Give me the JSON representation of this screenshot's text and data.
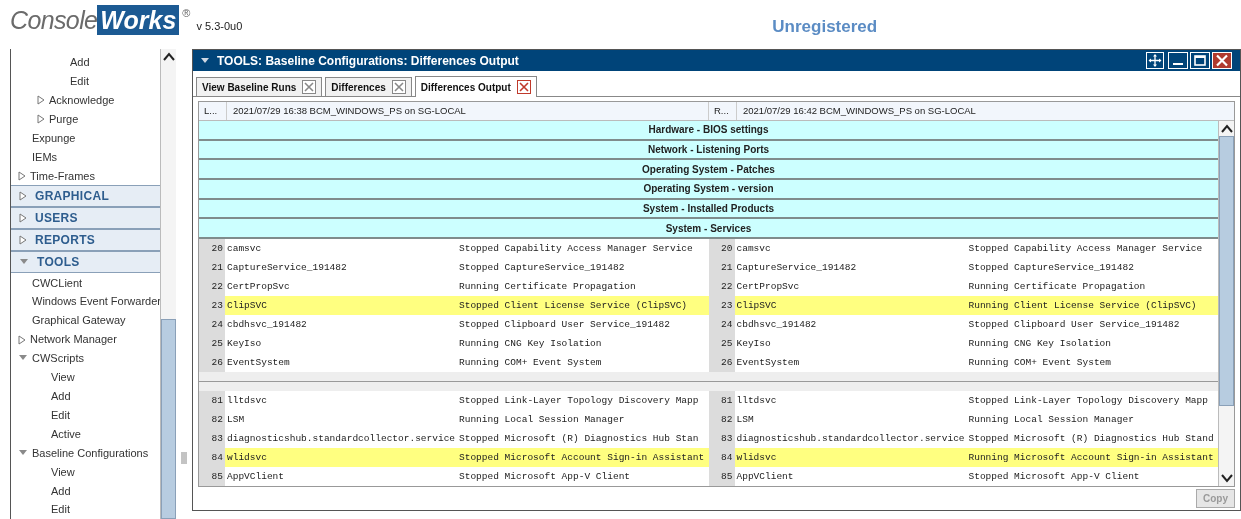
{
  "header": {
    "logo_left": "Console",
    "logo_right": "Works",
    "logo_mark": "®",
    "version": "v 5.3-0u0",
    "license": "Unregistered"
  },
  "sidebar": {
    "sections": [
      {
        "items": [
          {
            "children": [
              {
                "children": [
                  {
                    "label": "Add"
                  },
                  {
                    "label": "Edit"
                  }
                ]
              },
              {
                "label": "Acknowledge",
                "expanded": false
              },
              {
                "label": "Purge",
                "expanded": false
              }
            ]
          },
          {
            "label": "Expunge"
          },
          {
            "label": "IEMs"
          },
          {
            "label": "Time-Frames",
            "expanded": false
          }
        ]
      },
      {
        "title": "GRAPHICAL",
        "expanded": false
      },
      {
        "title": "USERS",
        "expanded": false
      },
      {
        "title": "REPORTS",
        "expanded": false
      },
      {
        "title": "TOOLS",
        "expanded": true,
        "items": [
          {
            "label": "CWCLient"
          },
          {
            "label": "Windows Event Forwarder"
          },
          {
            "label": "Graphical Gateway"
          },
          {
            "label": "Network Manager",
            "expanded": false
          },
          {
            "label": "CWScripts",
            "expanded": true,
            "children": [
              {
                "label": "View"
              },
              {
                "label": "Add"
              },
              {
                "label": "Edit"
              },
              {
                "label": "Active"
              }
            ]
          },
          {
            "label": "Baseline Configurations",
            "expanded": true,
            "children": [
              {
                "label": "View"
              },
              {
                "label": "Add"
              },
              {
                "label": "Edit"
              }
            ]
          }
        ]
      }
    ]
  },
  "panel": {
    "title": "TOOLS: Baseline Configurations: Differences Output",
    "tabs": [
      {
        "label": "View Baseline Runs",
        "selected": false
      },
      {
        "label": "Differences",
        "selected": false
      },
      {
        "label": "Differences Output",
        "selected": true
      }
    ],
    "columns": {
      "left_label": "L...",
      "left_run": "2021/07/29 16:38 BCM_WINDOWS_PS on SG-LOCAL",
      "right_label": "R...",
      "right_run": "2021/07/29 16:42 BCM_WINDOWS_PS on SG-LOCAL"
    },
    "sections": [
      {
        "title": "Hardware - BIOS settings"
      },
      {
        "title": "Network - Listening Ports"
      },
      {
        "title": "Operating System - Patches"
      },
      {
        "title": "Operating System - version"
      },
      {
        "title": "System - Installed Products"
      },
      {
        "title": "System - Services"
      }
    ],
    "groups": [
      {
        "rows": [
          {
            "changed": false,
            "left": {
              "number": "20",
              "name": "camsvc",
              "status": "Stopped Capability Access Manager Service"
            },
            "right": {
              "number": "20",
              "name": "camsvc",
              "status": "Stopped Capability Access Manager Service"
            }
          },
          {
            "changed": false,
            "left": {
              "number": "21",
              "name": "CaptureService_191482",
              "status": "Stopped CaptureService_191482"
            },
            "right": {
              "number": "21",
              "name": "CaptureService_191482",
              "status": "Stopped CaptureService_191482"
            }
          },
          {
            "changed": false,
            "left": {
              "number": "22",
              "name": "CertPropSvc",
              "status": "Running Certificate Propagation"
            },
            "right": {
              "number": "22",
              "name": "CertPropSvc",
              "status": "Running Certificate Propagation"
            }
          },
          {
            "changed": true,
            "left": {
              "number": "23",
              "name": "ClipSVC",
              "status": "Stopped Client License Service (ClipSVC)"
            },
            "right": {
              "number": "23",
              "name": "ClipSVC",
              "status": "Running Client License Service (ClipSVC)"
            }
          },
          {
            "changed": false,
            "left": {
              "number": "24",
              "name": "cbdhsvc_191482",
              "status": "Stopped Clipboard User Service_191482"
            },
            "right": {
              "number": "24",
              "name": "cbdhsvc_191482",
              "status": "Stopped Clipboard User Service_191482"
            }
          },
          {
            "changed": false,
            "left": {
              "number": "25",
              "name": "KeyIso",
              "status": "Running CNG Key Isolation"
            },
            "right": {
              "number": "25",
              "name": "KeyIso",
              "status": "Running CNG Key Isolation"
            }
          },
          {
            "changed": false,
            "left": {
              "number": "26",
              "name": "EventSystem",
              "status": "Running COM+ Event System"
            },
            "right": {
              "number": "26",
              "name": "EventSystem",
              "status": "Running COM+ Event System"
            }
          }
        ]
      },
      {
        "rows": [
          {
            "changed": false,
            "left": {
              "number": "81",
              "name": "lltdsvc",
              "status": "Stopped Link-Layer Topology Discovery Mapp"
            },
            "right": {
              "number": "81",
              "name": "lltdsvc",
              "status": "Stopped Link-Layer Topology Discovery Mapp"
            }
          },
          {
            "changed": false,
            "left": {
              "number": "82",
              "name": "LSM",
              "status": "Running Local Session Manager"
            },
            "right": {
              "number": "82",
              "name": "LSM",
              "status": "Running Local Session Manager"
            }
          },
          {
            "changed": false,
            "left": {
              "number": "83",
              "name": "diagnosticshub.standardcollector.service",
              "status": "Stopped Microsoft (R) Diagnostics Hub Stan"
            },
            "right": {
              "number": "83",
              "name": "diagnosticshub.standardcollector.service",
              "status": "Stopped Microsoft (R) Diagnostics Hub Stand"
            }
          },
          {
            "changed": true,
            "left": {
              "number": "84",
              "name": "wlidsvc",
              "status": "Stopped Microsoft Account Sign-in Assistant"
            },
            "right": {
              "number": "84",
              "name": "wlidsvc",
              "status": "Running Microsoft Account Sign-in Assistant"
            }
          },
          {
            "changed": false,
            "left": {
              "number": "85",
              "name": "AppVClient",
              "status": "Stopped Microsoft App-V Client"
            },
            "right": {
              "number": "85",
              "name": "AppVClient",
              "status": "Stopped Microsoft App-V Client"
            }
          }
        ]
      }
    ],
    "copy_button": {
      "label": "Copy",
      "disabled": true
    }
  }
}
